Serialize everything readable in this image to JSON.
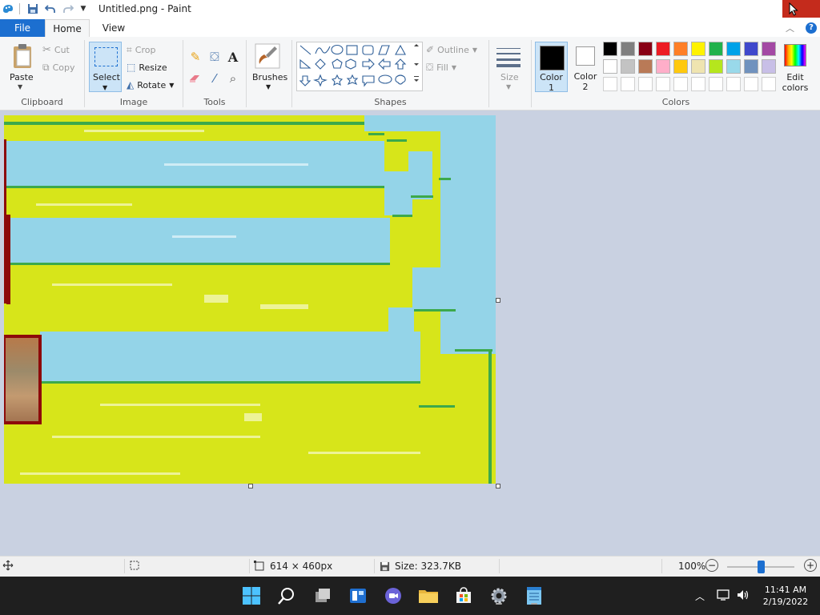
{
  "titlebar": {
    "title": "Untitled.png - Paint",
    "close_color": "#c42b1c"
  },
  "tabs": {
    "file": "File",
    "home": "Home",
    "view": "View"
  },
  "ribbon": {
    "clipboard": {
      "paste": "Paste",
      "cut": "Cut",
      "copy": "Copy",
      "label": "Clipboard"
    },
    "image": {
      "select": "Select",
      "crop": "Crop",
      "resize": "Resize",
      "rotate": "Rotate",
      "label": "Image"
    },
    "tools": {
      "label": "Tools",
      "text_tool": "A"
    },
    "brushes": {
      "label": "Brushes"
    },
    "shapes": {
      "outline": "Outline",
      "fill": "Fill",
      "label": "Shapes"
    },
    "size": {
      "label": "Size"
    },
    "colors": {
      "color1_line1": "Color",
      "color1_line2": "1",
      "color2_line1": "Color",
      "color2_line2": "2",
      "edit_line1": "Edit",
      "edit_line2": "colors",
      "label": "Colors",
      "color1_value": "#000000",
      "color2_value": "#ffffff",
      "palette_row1": [
        "#000000",
        "#7f7f7f",
        "#880015",
        "#ed1c24",
        "#ff7f27",
        "#fff200",
        "#22b14c",
        "#00a2e8",
        "#3f48cc",
        "#a349a4"
      ],
      "palette_row2": [
        "#ffffff",
        "#c3c3c3",
        "#b97a57",
        "#ffaec9",
        "#ffc90e",
        "#efe4b0",
        "#b5e61d",
        "#99d9ea",
        "#7092be",
        "#c8bfe7"
      ],
      "palette_row3": [
        "#ffffff",
        "#ffffff",
        "#ffffff",
        "#ffffff",
        "#ffffff",
        "#ffffff",
        "#ffffff",
        "#ffffff",
        "#ffffff",
        "#ffffff"
      ]
    }
  },
  "status": {
    "dimensions": "614 × 460px",
    "size": "Size: 323.7KB",
    "zoom": "100%",
    "zoom_minus": "−",
    "zoom_plus": "+"
  },
  "taskbar": {
    "time": "11:41 AM",
    "date": "2/19/2022"
  }
}
